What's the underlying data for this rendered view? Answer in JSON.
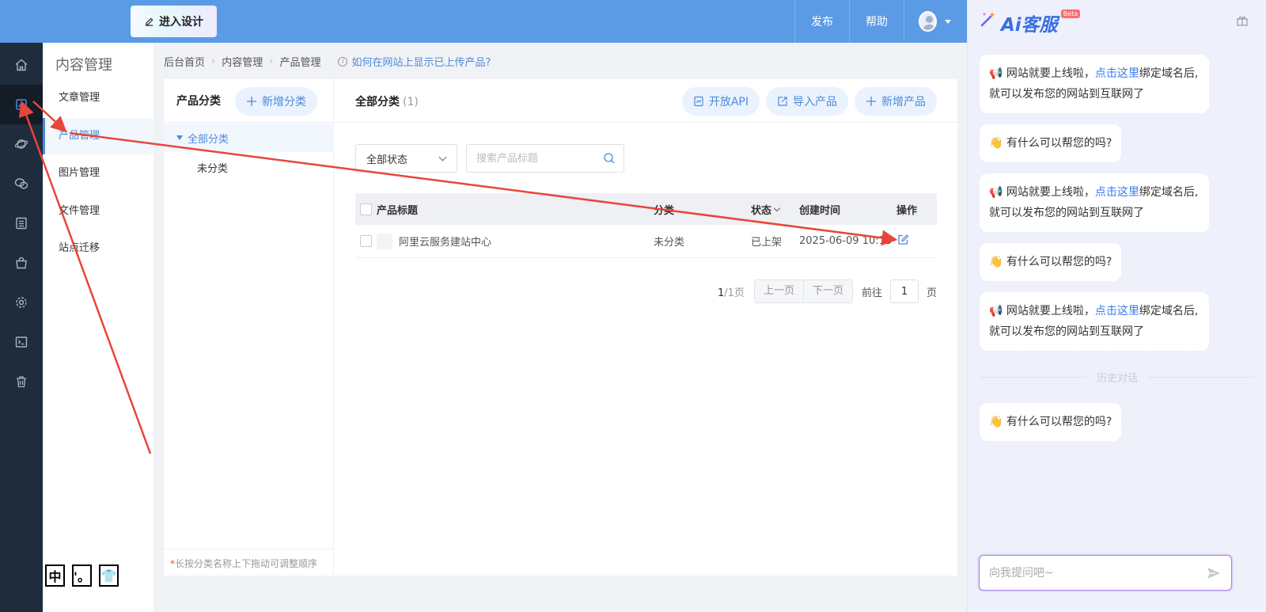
{
  "topbar": {
    "design_button": "进入设计",
    "publish": "发布",
    "help": "帮助"
  },
  "rail": {
    "items": [
      "home-icon",
      "content-icon",
      "planet-icon",
      "chat-icon",
      "list-icon",
      "bag-icon",
      "gear-icon",
      "terminal-icon",
      "trash-icon"
    ]
  },
  "submenu": {
    "title": "内容管理",
    "items": [
      "文章管理",
      "产品管理",
      "图片管理",
      "文件管理",
      "站点迁移"
    ],
    "active": "产品管理"
  },
  "mini_tools": [
    "中",
    "'。",
    "👕"
  ],
  "breadcrumb": {
    "items": [
      "后台首页",
      "内容管理",
      "产品管理"
    ],
    "help_link": "如何在网站上显示已上传产品?"
  },
  "category_panel": {
    "title": "产品分类",
    "add_button": "新增分类",
    "all_label": "全部分类",
    "uncategorized": "未分类",
    "tip": "长按分类名称上下拖动可调整顺序",
    "tip_star": "*"
  },
  "main": {
    "title": "全部分类",
    "count": "(1)",
    "actions": [
      "开放API",
      "导入产品",
      "新增产品"
    ],
    "status_filter": "全部状态",
    "search_placeholder": "搜索产品标题",
    "columns": [
      "产品标题",
      "分类",
      "状态",
      "创建时间",
      "操作"
    ],
    "rows": [
      {
        "title": "阿里云服务建站中心",
        "category": "未分类",
        "status": "已上架",
        "created": "2025-06-09 10:13"
      }
    ],
    "pager": {
      "current": "1",
      "total": "/1页",
      "prev": "上一页",
      "next": "下一页",
      "goto": "前往",
      "page_input": "1",
      "page_unit": "页"
    }
  },
  "ai_panel": {
    "brand": "Ai客服",
    "beta": "Beta",
    "messages": [
      {
        "pre": "网站就要上线啦，",
        "link": "点击这里",
        "post": "绑定域名后,就可以发布您的网站到互联网了"
      },
      {
        "text": "有什么可以帮您的吗?"
      },
      {
        "pre": "网站就要上线啦，",
        "link": "点击这里",
        "post": "绑定域名后,就可以发布您的网站到互联网了"
      },
      {
        "text": "有什么可以帮您的吗?"
      },
      {
        "pre": "网站就要上线啦，",
        "link": "点击这里",
        "post": "绑定域名后,就可以发布您的网站到互联网了"
      },
      {
        "text": "有什么可以帮您的吗?"
      }
    ],
    "history_label": "历史对话",
    "input_placeholder": "向我提问吧~"
  },
  "colors": {
    "topbar": "#5b9be6",
    "rail": "#1f2c3c",
    "accent": "#4d8ad9",
    "annotation_arrow": "#e8463a"
  }
}
